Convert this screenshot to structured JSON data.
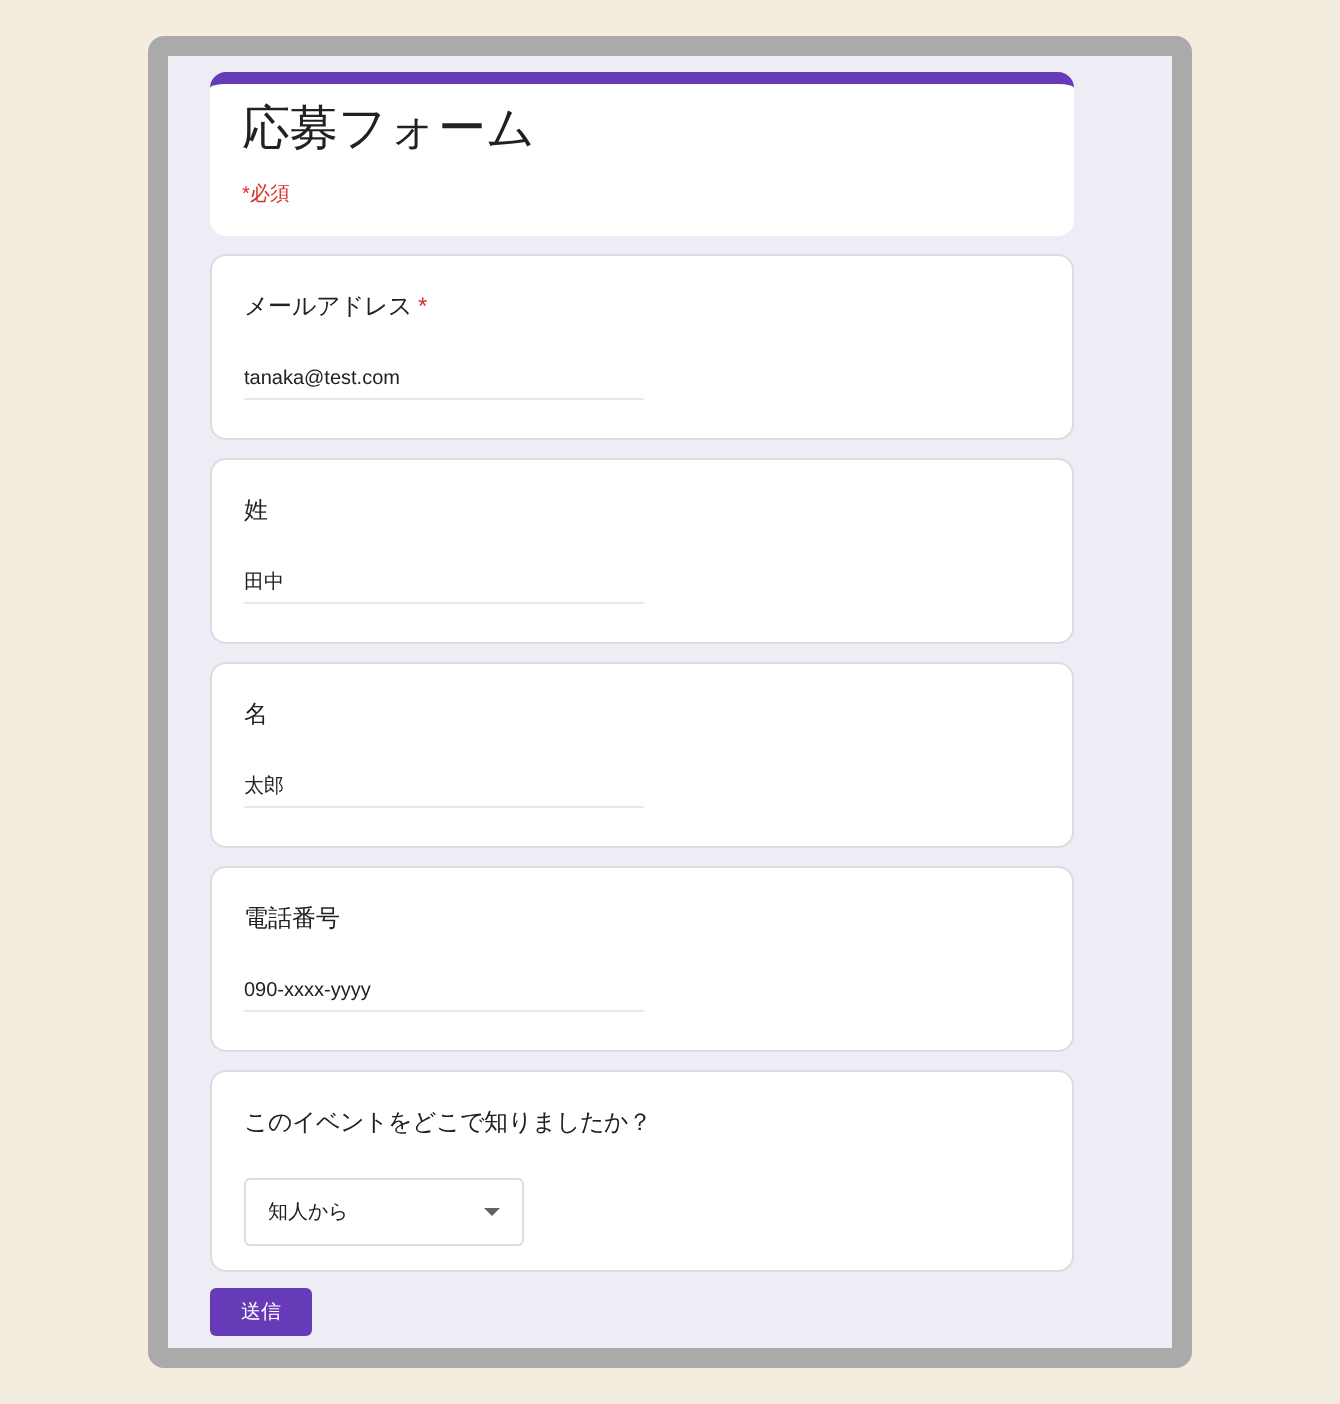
{
  "form": {
    "title": "応募フォーム",
    "required_note": "*必須"
  },
  "questions": [
    {
      "kind": "text",
      "label": "メールアドレス",
      "required": true,
      "value": "tanaka@test.com"
    },
    {
      "kind": "text",
      "label": "姓",
      "required": false,
      "value": "田中"
    },
    {
      "kind": "text",
      "label": "名",
      "required": false,
      "value": "太郎"
    },
    {
      "kind": "text",
      "label": "電話番号",
      "required": false,
      "value": "090-xxxx-yyyy"
    },
    {
      "kind": "dropdown",
      "label": "このイベントをどこで知りましたか？",
      "required": false,
      "value": "知人から"
    }
  ],
  "required_mark": "*",
  "submit": "送信"
}
